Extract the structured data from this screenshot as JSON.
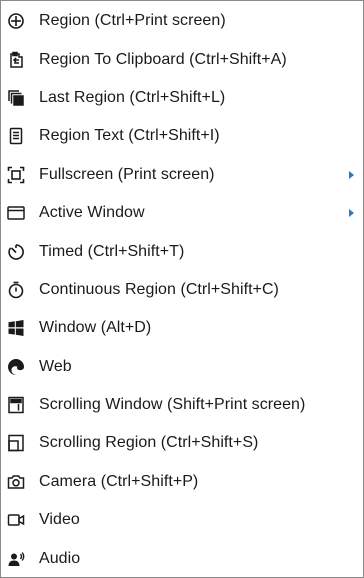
{
  "menu": {
    "items": [
      {
        "label": "Region (Ctrl+Print screen)",
        "icon": "crosshair-icon",
        "submenu": false
      },
      {
        "label": "Region To Clipboard (Ctrl+Shift+A)",
        "icon": "clipboard-icon",
        "submenu": false
      },
      {
        "label": "Last Region (Ctrl+Shift+L)",
        "icon": "stacked-squares-icon",
        "submenu": false
      },
      {
        "label": "Region Text (Ctrl+Shift+I)",
        "icon": "document-text-icon",
        "submenu": false
      },
      {
        "label": "Fullscreen (Print screen)",
        "icon": "fullscreen-icon",
        "submenu": true
      },
      {
        "label": "Active Window",
        "icon": "window-icon",
        "submenu": true
      },
      {
        "label": "Timed (Ctrl+Shift+T)",
        "icon": "timer-icon",
        "submenu": false
      },
      {
        "label": "Continuous Region (Ctrl+Shift+C)",
        "icon": "stopwatch-icon",
        "submenu": false
      },
      {
        "label": "Window (Alt+D)",
        "icon": "windows-logo-icon",
        "submenu": false
      },
      {
        "label": "Web",
        "icon": "edge-browser-icon",
        "submenu": false
      },
      {
        "label": "Scrolling Window (Shift+Print screen)",
        "icon": "scrolling-window-icon",
        "submenu": false
      },
      {
        "label": "Scrolling Region (Ctrl+Shift+S)",
        "icon": "scrolling-region-icon",
        "submenu": false
      },
      {
        "label": "Camera (Ctrl+Shift+P)",
        "icon": "camera-icon",
        "submenu": false
      },
      {
        "label": "Video",
        "icon": "video-camera-icon",
        "submenu": false
      },
      {
        "label": "Audio",
        "icon": "microphone-person-icon",
        "submenu": false
      }
    ],
    "colors": {
      "text": "#1a1a1a",
      "icon": "#1a1a1a",
      "arrow": "#2b78c6",
      "border": "#8a8a8a",
      "background": "#ffffff"
    }
  }
}
